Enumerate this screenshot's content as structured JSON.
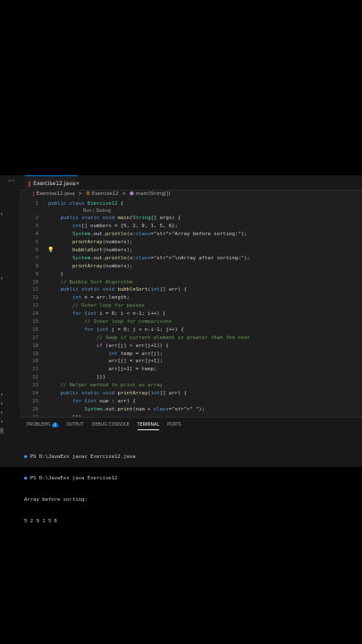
{
  "titlebar": {
    "menu_dots": "···"
  },
  "tab": {
    "icon": "J",
    "label": "Exercise12.java",
    "close": "✕"
  },
  "breadcrumb": {
    "file": "Exercise12.java",
    "sep": ">",
    "class": "Exercise12",
    "method": "main(String[])"
  },
  "codelens": "Run | Debug",
  "lines": [
    {
      "n": "1",
      "t": "public class Exercise12 {"
    },
    {
      "n": "2",
      "t": "    public static void main(String[] args) {"
    },
    {
      "n": "3",
      "t": "        int[] numbers = {5, 2, 9, 1, 5, 6};"
    },
    {
      "n": "4",
      "t": "        System.out.println(x:\"Array before sorting:\");"
    },
    {
      "n": "5",
      "t": "        printArray(numbers);"
    },
    {
      "n": "6",
      "t": "        bubbleSort(numbers);"
    },
    {
      "n": "7",
      "t": "        System.out.println(x:\"\\nArray after sorting:\");"
    },
    {
      "n": "8",
      "t": "        printArray(numbers);"
    },
    {
      "n": "9",
      "t": "    }"
    },
    {
      "n": "10",
      "t": "    // Bubble Sort Algorithm"
    },
    {
      "n": "11",
      "t": "    public static void bubbleSort(int[] arr) {"
    },
    {
      "n": "12",
      "t": "        int n = arr.length;"
    },
    {
      "n": "13",
      "t": "        // Outer loop for passes"
    },
    {
      "n": "14",
      "t": "        for (int i = 0; i < n-1; i++) {"
    },
    {
      "n": "15",
      "t": "            // Inner loop for comparisons"
    },
    {
      "n": "16",
      "t": "            for (int j = 0; j < n-i-1; j++) {"
    },
    {
      "n": "17",
      "t": "                // Swap if current element is greater than the next"
    },
    {
      "n": "18",
      "t": "                if (arr[j] > arr[j+1]) {"
    },
    {
      "n": "19",
      "t": "                    int temp = arr[j];"
    },
    {
      "n": "20",
      "t": "                    arr[j] = arr[j+1];"
    },
    {
      "n": "21",
      "t": "                    arr[j+1] = temp;"
    },
    {
      "n": "22",
      "t": "                }}}"
    },
    {
      "n": "23",
      "t": "    // Helper method to print an array"
    },
    {
      "n": "24",
      "t": "    public static void printArray(int[] arr) {"
    },
    {
      "n": "25",
      "t": "        for (int num : arr) {"
    },
    {
      "n": "26",
      "t": "            System.out.print(num + \" \");"
    },
    {
      "n": "27",
      "t": "        }}}"
    },
    {
      "n": "28",
      "t": ""
    }
  ],
  "panel": {
    "tabs": [
      "PROBLEMS",
      "OUTPUT",
      "DEBUG CONSOLE",
      "TERMINAL",
      "PORTS"
    ],
    "problems_count": "2",
    "active_tab": "TERMINAL"
  },
  "terminal": [
    "PS D:\\JavaExs javac Exercise12.java",
    "PS D:\\JavaExs java Exercise12",
    "Array before sorting:",
    "5 2 9 1 5 6"
  ],
  "colors": {
    "accent": "#0078d4",
    "editor_bg": "#1f1f1f",
    "keyword": "#569cd6",
    "comment": "#6a9955"
  }
}
